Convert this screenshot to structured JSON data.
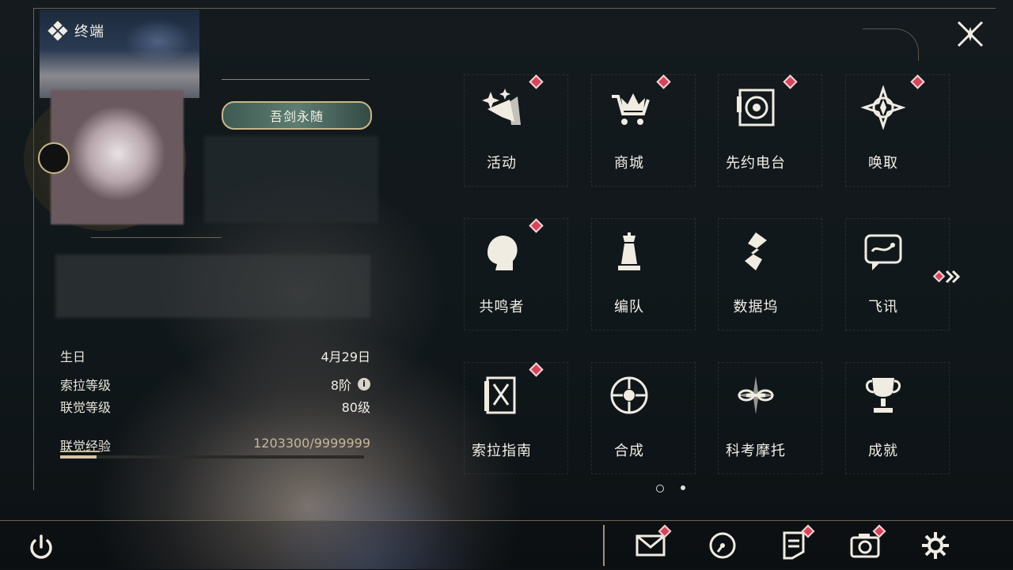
{
  "header": {
    "title": "终端"
  },
  "profile": {
    "title_badge": "吾剑永随",
    "stats": [
      {
        "label": "生日",
        "value": "4月29日"
      },
      {
        "label": "索拉等级",
        "value": "8阶"
      },
      {
        "label": "联觉等级",
        "value": "80级"
      }
    ],
    "exp": {
      "label": "联觉经验",
      "value": "1203300/9999999",
      "progress": 0.12
    }
  },
  "menu": [
    {
      "label": "活动",
      "icon": "sparkle-icon",
      "badge": true
    },
    {
      "label": "商城",
      "icon": "crown-cart-icon",
      "badge": true
    },
    {
      "label": "先约电台",
      "icon": "radio-icon",
      "badge": true
    },
    {
      "label": "唤取",
      "icon": "compass-star-icon",
      "badge": true
    },
    {
      "label": "共鸣者",
      "icon": "character-icon",
      "badge": true
    },
    {
      "label": "编队",
      "icon": "chess-icon",
      "badge": false
    },
    {
      "label": "数据坞",
      "icon": "data-dock-icon",
      "badge": false
    },
    {
      "label": "飞讯",
      "icon": "chat-icon",
      "badge": false
    },
    {
      "label": "索拉指南",
      "icon": "guide-icon",
      "badge": true
    },
    {
      "label": "合成",
      "icon": "synthesis-icon",
      "badge": false
    },
    {
      "label": "科考摩托",
      "icon": "motorbike-icon",
      "badge": false
    },
    {
      "label": "成就",
      "icon": "trophy-icon",
      "badge": false
    }
  ],
  "pagination": {
    "current": 1,
    "total": 2
  },
  "bottom": {
    "items": [
      {
        "icon": "mail-icon",
        "badge": true
      },
      {
        "icon": "clock-icon",
        "badge": false
      },
      {
        "icon": "notice-icon",
        "badge": true
      },
      {
        "icon": "camera-icon",
        "badge": true
      },
      {
        "icon": "settings-icon",
        "badge": false
      }
    ]
  },
  "colors": {
    "accent": "#d6c6a4",
    "badge": "#d6445a",
    "line": "#6b6551"
  }
}
